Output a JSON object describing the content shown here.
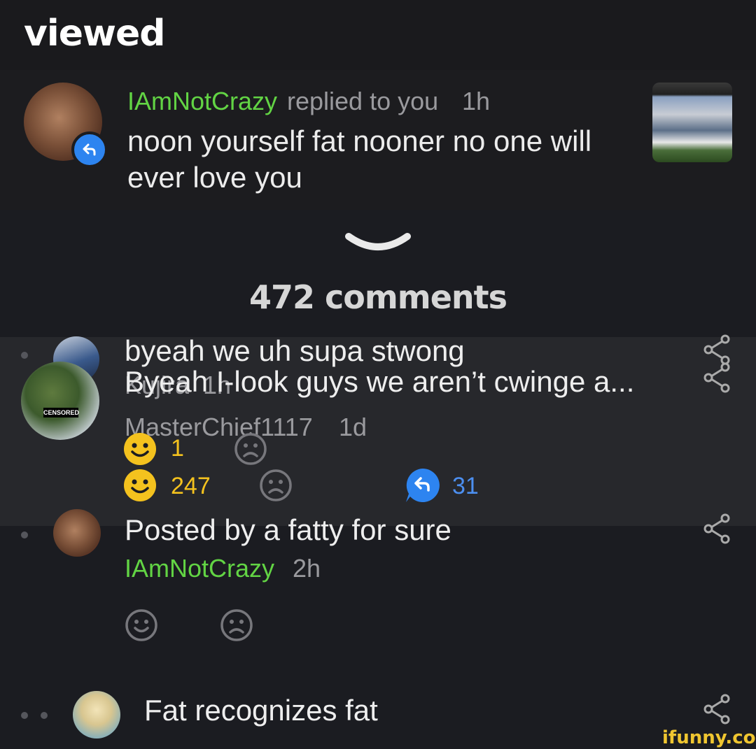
{
  "caption": "viewed",
  "notification": {
    "user": "IAmNotCrazy",
    "action": "replied to you",
    "time": "1h",
    "text": "noon yourself fat nooner no one will ever love you"
  },
  "comments_count": "472 comments",
  "thread": {
    "overlay_text": "byeah we uh supa stwong",
    "overlay_user": "Kujira",
    "overlay_time": "1h",
    "overlay_smile_count": "1",
    "main_text": "Byeah I-look guys we aren’t cwinge a...",
    "main_user": "MasterChief1117",
    "main_time": "1d",
    "smile_count": "247",
    "reply_count": "31"
  },
  "comment2": {
    "text": "Posted by a fatty for sure",
    "user": "IAmNotCrazy",
    "time": "2h"
  },
  "comment3": {
    "text": "Fat recognizes fat"
  },
  "watermark": "ifunny.co",
  "censored_label": "CENSORED",
  "colors": {
    "background": "#1b1c21",
    "username_green": "#62d444",
    "reply_blue": "#2d84f0",
    "smile_yellow": "#f4c21e"
  },
  "icons": [
    "reply-icon",
    "share-icon",
    "smile-icon",
    "frown-icon",
    "chevron-down-icon"
  ]
}
